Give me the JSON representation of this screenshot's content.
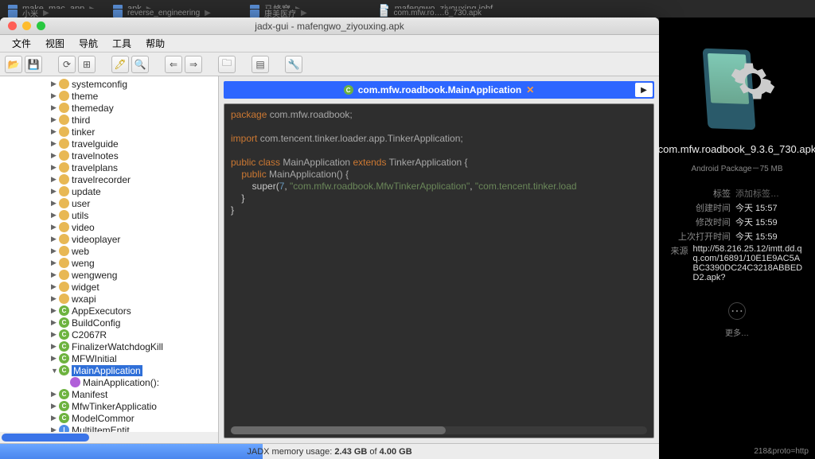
{
  "bgRow": {
    "c1a": "make_mac_app",
    "c1b": "小米",
    "c2a": "apk",
    "c2b": "reverse_engineering",
    "c3a": "马蜂窝",
    "c3b": "康美医疗",
    "c4a": "mafengwo_ziyouxing.jobf",
    "c4b": "com.mfw.ro….6_730.apk"
  },
  "window": {
    "title": "jadx-gui - mafengwo_ziyouxing.apk"
  },
  "menu": {
    "file": "文件",
    "view": "视图",
    "nav": "导航",
    "tools": "工具",
    "help": "帮助"
  },
  "tree": {
    "pkgs": [
      "systemconfig",
      "theme",
      "themeday",
      "third",
      "tinker",
      "travelguide",
      "travelnotes",
      "travelplans",
      "travelrecorder",
      "update",
      "user",
      "utils",
      "video",
      "videoplayer",
      "web",
      "weng",
      "wengweng",
      "widget",
      "wxapi"
    ],
    "classes": [
      "AppExecutors",
      "BuildConfig",
      "C2067R",
      "FinalizerWatchdogKill",
      "MFWInitial"
    ],
    "selected": "MainApplication",
    "selectedChild": "MainApplication():",
    "after": [
      "Manifest",
      "MfwTinkerApplicatio",
      "ModelCommor"
    ],
    "afterI": "MultiItemEntit"
  },
  "tab": {
    "title": "com.mfw.roadbook.MainApplication"
  },
  "code": {
    "l1a": "package ",
    "l1b": "com.mfw.roadbook;",
    "l2a": "import ",
    "l2b": "com.tencent.tinker.loader.app.TinkerApplication;",
    "l3a": "public class ",
    "l3b": "MainApplication ",
    "l3c": "extends ",
    "l3d": "TinkerApplication {",
    "l4a": "    public ",
    "l4b": "MainApplication() {",
    "l5a": "        super(",
    "l5b": "7",
    "l5c": ", ",
    "l5d": "\"com.mfw.roadbook.MfwTinkerApplication\"",
    "l5e": ", ",
    "l5f": "\"com.tencent.tinker.load",
    "l6": "    }",
    "l7": "}"
  },
  "status": {
    "pre": "JADX memory usage: ",
    "used": "2.43 GB",
    "mid": " of ",
    "total": "4.00 GB"
  },
  "info": {
    "filename": "com.mfw.roadbook_9.3.6_730.apk",
    "kind": "Android Package－75 MB",
    "labels": {
      "tag": "标签",
      "created": "创建时间",
      "modified": "修改时间",
      "opened": "上次打开时间",
      "source": "来源"
    },
    "values": {
      "tag": "添加标签…",
      "created": "今天 15:57",
      "modified": "今天 15:59",
      "opened": "今天 15:59",
      "source": "http://58.216.25.12/imtt.dd.qq.com/16891/10E1E9AC5ABC3390DC24C3218ABBEDD2.apk?"
    },
    "more": "更多…",
    "foot": "218&proto=http"
  }
}
